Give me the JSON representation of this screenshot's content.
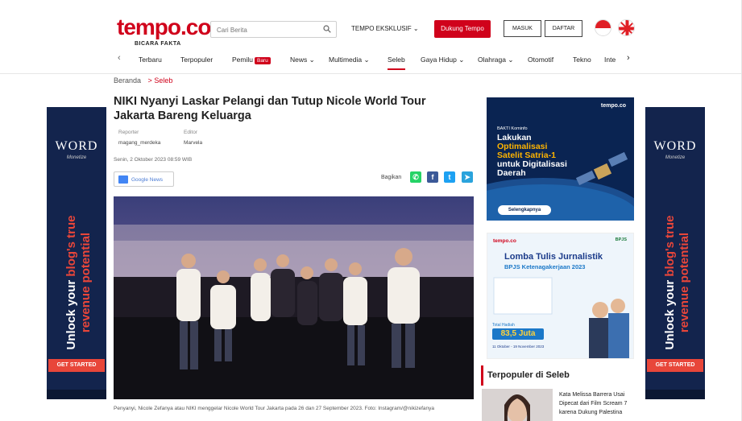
{
  "header": {
    "logo": "tempo.co",
    "tagline": "BICARA FAKTA",
    "search_placeholder": "Cari Berita",
    "eksklusif": "TEMPO EKSKLUSIF ⌄",
    "dukung": "Dukung Tempo",
    "masuk": "MASUK",
    "daftar": "DAFTAR"
  },
  "nav": {
    "prev": "‹",
    "next": "›",
    "items": [
      "Terbaru",
      "Terpopuler",
      "Pemilu",
      "News ⌄",
      "Multimedia ⌄",
      "Seleb",
      "Gaya Hidup ⌄",
      "Olahraga ⌄",
      "Otomotif",
      "Tekno",
      "Inte"
    ],
    "baru": "Baru"
  },
  "breadcrumb": {
    "home": "Beranda",
    "sep": ">",
    "section": "Seleb"
  },
  "article": {
    "title": "NIKI Nyanyi Laskar Pelangi dan Tutup Nicole World Tour Jakarta Bareng Keluarga",
    "reporter_label": "Reporter",
    "reporter": "magang_merdeka",
    "editor_label": "Editor",
    "editor": "Marvela",
    "date": "Senin, 2 Oktober 2023 08:59 WIB",
    "gnews": "Google News",
    "bagikan": "Bagikan",
    "caption": "Penyanyi, Nicole Zefanya atau NIKI menggelar Nicole World Tour Jakarta pada 26 dan 27 September 2023. Foto: Instagram/@nikizefanya"
  },
  "ad_side": {
    "logo": "WORD",
    "sub": "Monetize",
    "line1a": "Unlock your ",
    "line1b": "blog's true",
    "line2": "revenue potential",
    "cta": "GET STARTED"
  },
  "ad1": {
    "brand": "tempo.co",
    "small": "BAKTI Kominfo",
    "l1": "Lakukan",
    "l2": "Optimalisasi",
    "l3": "Satelit Satria-1",
    "l4": "untuk Digitalisasi",
    "l5": "Daerah",
    "btn": "Selengkapnya"
  },
  "ad2": {
    "brand": "tempo.co",
    "partner": "BPJS",
    "title": "Lomba Tulis Jurnalistik",
    "sub": "BPJS Ketenagakerjaan 2023",
    "prize_label": "Total Hadiah",
    "prize": "83,5 Juta",
    "dates": "11 Oktober - 19 November 2023"
  },
  "trending": {
    "title": "Terpopuler di Seleb",
    "item1": "Kata Melissa Barrera Usai Dipecat dari Film Scream 7 karena Dukung Palestina"
  },
  "colors": {
    "brand_red": "#d0021b",
    "ad_navy": "#13244d",
    "ad_accent": "#e8463a"
  },
  "icons": [
    "search-icon",
    "whatsapp-icon",
    "facebook-icon",
    "twitter-icon",
    "telegram-icon",
    "flag-id-icon",
    "flag-uk-icon"
  ]
}
